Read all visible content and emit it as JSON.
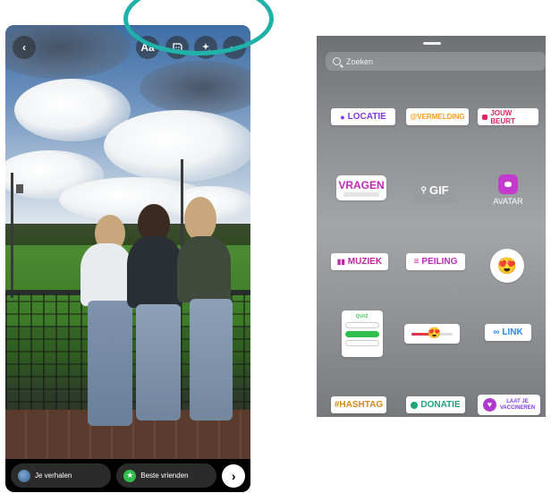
{
  "editor": {
    "back_icon": "chevron-left-icon",
    "tools": {
      "text_label": "Aa",
      "sticker_icon": "sticker-icon",
      "effects_icon": "sparkles-icon",
      "more_label": "···"
    },
    "highlight_color": "#20b2aa",
    "bottom": {
      "your_story_label": "Je verhalen",
      "close_friends_label": "Beste vrienden",
      "next_label": "›"
    }
  },
  "sticker_tray": {
    "search_placeholder": "Zoeken",
    "stickers": {
      "locatie": "LOCATIE",
      "vermelding": "@VERMELDING",
      "jouw_beurt": "JOUW BEURT",
      "vragen": "VRAGEN",
      "gif": "GIF",
      "avatar": "AVATAR",
      "muziek": "MUZIEK",
      "peiling": "PEILING",
      "emoji_reaction": "😍",
      "quiz": "QUIZ",
      "emoji_slider": "😍",
      "link": "LINK",
      "hashtag": "#HASHTAG",
      "donatie": "DONATIE",
      "vaccine_line1": "LAAT JE",
      "vaccine_line2": "VACCINEREN"
    }
  }
}
